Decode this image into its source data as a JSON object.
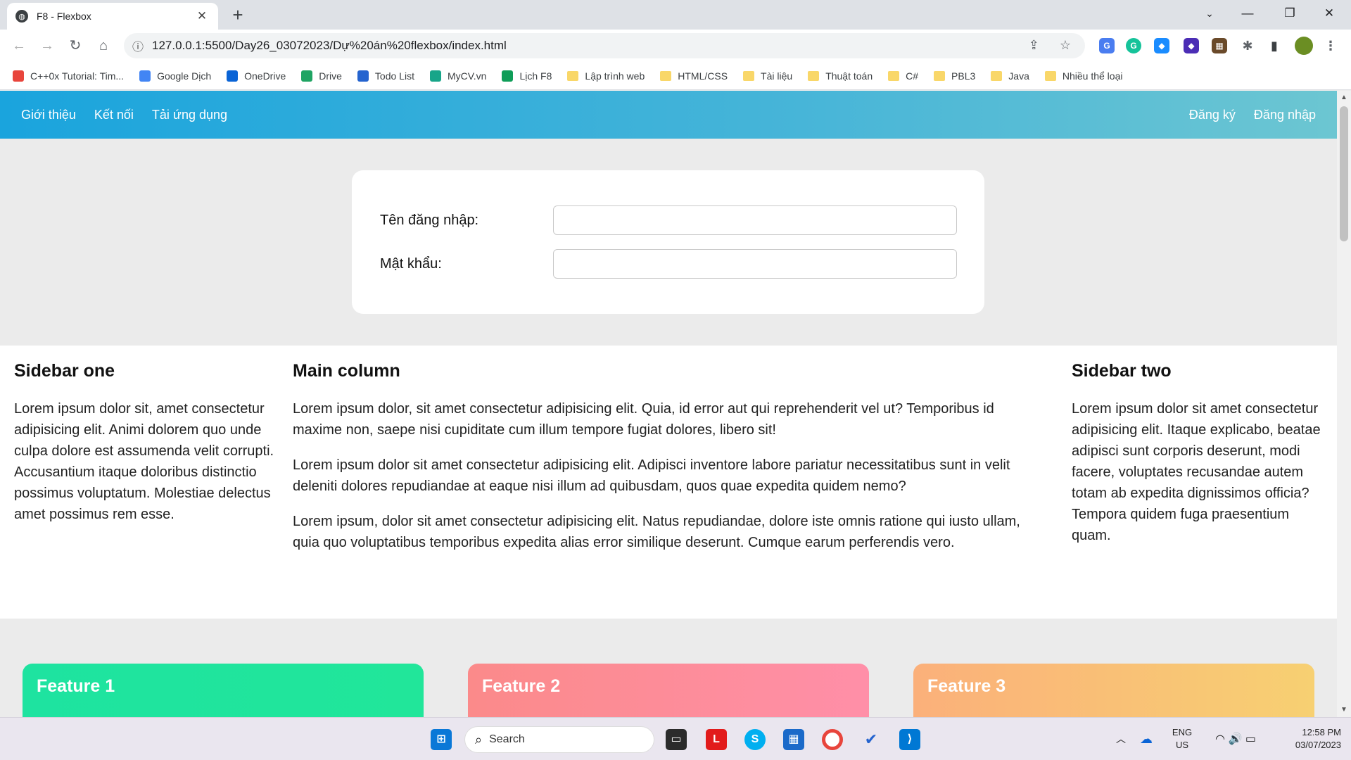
{
  "browser": {
    "tab_title": "F8 - Flexbox",
    "url": "127.0.0.1:5500/Day26_03072023/Dự%20án%20flexbox/index.html",
    "bookmarks": [
      {
        "label": "C++0x Tutorial: Tim...",
        "icon": "chrome-icon",
        "color": "#e8453c"
      },
      {
        "label": "Google Dịch",
        "icon": "translate-icon",
        "color": "#4285f4"
      },
      {
        "label": "OneDrive",
        "icon": "cloud-icon",
        "color": "#0a64d6"
      },
      {
        "label": "Drive",
        "icon": "drive-icon",
        "color": "#1fa463"
      },
      {
        "label": "Todo List",
        "icon": "check-icon",
        "color": "#2564cf"
      },
      {
        "label": "MyCV.vn",
        "icon": "mycv-icon",
        "color": "#17a589"
      },
      {
        "label": "Lịch F8",
        "icon": "calendar-icon",
        "color": "#0f9d58"
      },
      {
        "label": "Lập trình web",
        "icon": "folder-icon",
        "color": "#f9d769"
      },
      {
        "label": "HTML/CSS",
        "icon": "folder-icon",
        "color": "#f9d769"
      },
      {
        "label": "Tài liệu",
        "icon": "folder-icon",
        "color": "#f9d769"
      },
      {
        "label": "Thuật toán",
        "icon": "folder-icon",
        "color": "#f9d769"
      },
      {
        "label": "C#",
        "icon": "folder-icon",
        "color": "#f9d769"
      },
      {
        "label": "PBL3",
        "icon": "folder-icon",
        "color": "#f9d769"
      },
      {
        "label": "Java",
        "icon": "folder-icon",
        "color": "#f9d769"
      },
      {
        "label": "Nhiều thể loại",
        "icon": "folder-icon",
        "color": "#f9d769"
      }
    ]
  },
  "site": {
    "nav_left": [
      "Giới thiệu",
      "Kết nối",
      "Tải ứng dụng"
    ],
    "nav_right": [
      "Đăng ký",
      "Đăng nhập"
    ],
    "login": {
      "username_label": "Tên đăng nhập:",
      "password_label": "Mật khẩu:"
    },
    "sidebar_one": {
      "title": "Sidebar one",
      "text": "Lorem ipsum dolor sit, amet consectetur adipisicing elit. Animi dolorem quo unde culpa dolore est assumenda velit corrupti. Accusantium itaque doloribus distinctio possimus voluptatum. Molestiae delectus amet possimus rem esse."
    },
    "main_column": {
      "title": "Main column",
      "paragraphs": [
        "Lorem ipsum dolor, sit amet consectetur adipisicing elit. Quia, id error aut qui reprehenderit vel ut? Temporibus id maxime non, saepe nisi cupiditate cum illum tempore fugiat dolores, libero sit!",
        "Lorem ipsum dolor sit amet consectetur adipisicing elit. Adipisci inventore labore pariatur necessitatibus sunt in velit deleniti dolores repudiandae at eaque nisi illum ad quibusdam, quos quae expedita quidem nemo?",
        "Lorem ipsum, dolor sit amet consectetur adipisicing elit. Natus repudiandae, dolore iste omnis ratione qui iusto ullam, quia quo voluptatibus temporibus expedita alias error similique deserunt. Cumque earum perferendis vero."
      ]
    },
    "sidebar_two": {
      "title": "Sidebar two",
      "text": "Lorem ipsum dolor sit amet consectetur adipisicing elit. Itaque explicabo, beatae adipisci sunt corporis deserunt, modi facere, voluptates recusandae autem totam ab expedita dignissimos officia? Tempora quidem fuga praesentium quam."
    },
    "features": [
      {
        "title": "Feature 1",
        "gradient": [
          "#1ee3a0",
          "#21e69a"
        ]
      },
      {
        "title": "Feature 2",
        "gradient": [
          "#fb8a8a",
          "#ff8fa8"
        ]
      },
      {
        "title": "Feature 3",
        "gradient": [
          "#fbb07a",
          "#f7d072"
        ]
      }
    ]
  },
  "taskbar": {
    "search_label": "Search",
    "lang_top": "ENG",
    "lang_bottom": "US",
    "time": "12:58 PM",
    "date": "03/07/2023"
  }
}
